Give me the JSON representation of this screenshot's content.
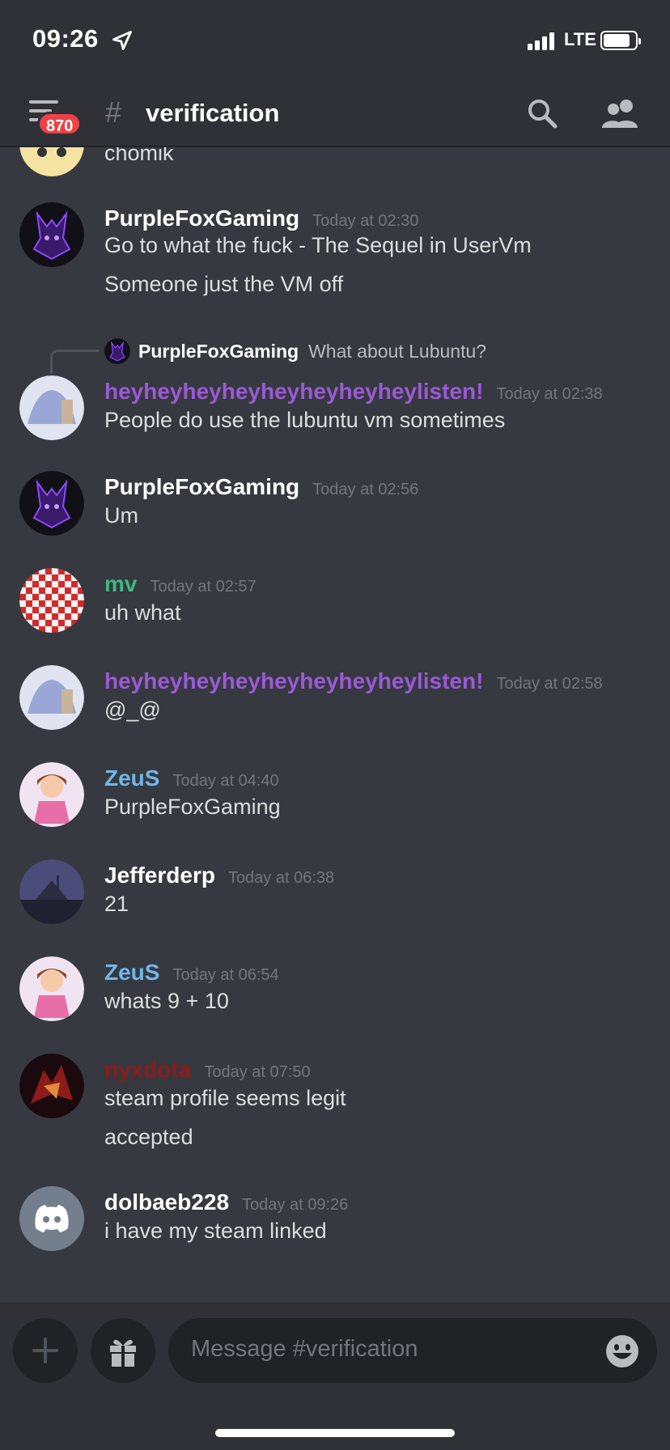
{
  "status_bar": {
    "time": "09:26",
    "network": "LTE"
  },
  "header": {
    "unread_badge": "870",
    "hash": "#",
    "channel": "verification"
  },
  "reply": {
    "author": "PurpleFoxGaming",
    "text": "What about Lubuntu?"
  },
  "messages": [
    {
      "author": "",
      "lines": [
        "chomik"
      ]
    },
    {
      "author": "PurpleFoxGaming",
      "time": "Today at 02:30",
      "lines": [
        "Go to what the fuck - The Sequel in UserVm",
        "Someone just the VM off"
      ]
    },
    {
      "author": "heyheyheyheyheyheyheyheylisten!",
      "time": "Today at 02:38",
      "lines": [
        "People do use the lubuntu vm sometimes"
      ]
    },
    {
      "author": "PurpleFoxGaming",
      "time": "Today at 02:56",
      "lines": [
        "Um"
      ]
    },
    {
      "author": "mv",
      "time": "Today at 02:57",
      "lines": [
        "uh what"
      ]
    },
    {
      "author": "heyheyheyheyheyheyheyheylisten!",
      "time": "Today at 02:58",
      "lines": [
        "@_@"
      ]
    },
    {
      "author": "ZeuS",
      "time": "Today at 04:40",
      "lines": [
        "PurpleFoxGaming"
      ]
    },
    {
      "author": "Jefferderp",
      "time": "Today at 06:38",
      "lines": [
        "21"
      ]
    },
    {
      "author": "ZeuS",
      "time": "Today at 06:54",
      "lines": [
        "whats 9 + 10"
      ]
    },
    {
      "author": "nyxdota",
      "time": "Today at 07:50",
      "lines": [
        "steam profile seems legit",
        "accepted"
      ]
    },
    {
      "author": "dolbaeb228",
      "time": "Today at 09:26",
      "lines": [
        "i have my steam linked"
      ]
    }
  ],
  "composer": {
    "placeholder": "Message #verification"
  },
  "colors": {
    "background": "#36393f",
    "header": "#2f3136",
    "purple_name": "#9b59d6",
    "green_name": "#43b581",
    "blue_name": "#71b5e8",
    "red_name": "#8b1a1a",
    "badge": "#ed4245"
  }
}
